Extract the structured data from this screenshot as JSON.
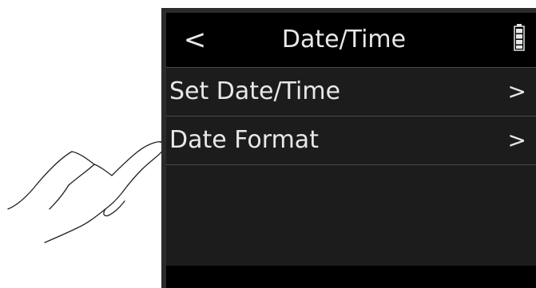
{
  "header": {
    "back_label": "<",
    "title": "Date/Time"
  },
  "menu": {
    "items": [
      {
        "label": "Set Date/Time",
        "chevron": ">"
      },
      {
        "label": "Date Format",
        "chevron": ">"
      }
    ]
  },
  "colors": {
    "screen_background": "#000000",
    "menu_background": "#1c1c1c",
    "text": "#e8e8e8",
    "divider": "#4a4a4a",
    "device_bezel": "#2b2b2b"
  },
  "icons": {
    "battery": "battery-icon",
    "hand": "pointing-hand-icon"
  }
}
